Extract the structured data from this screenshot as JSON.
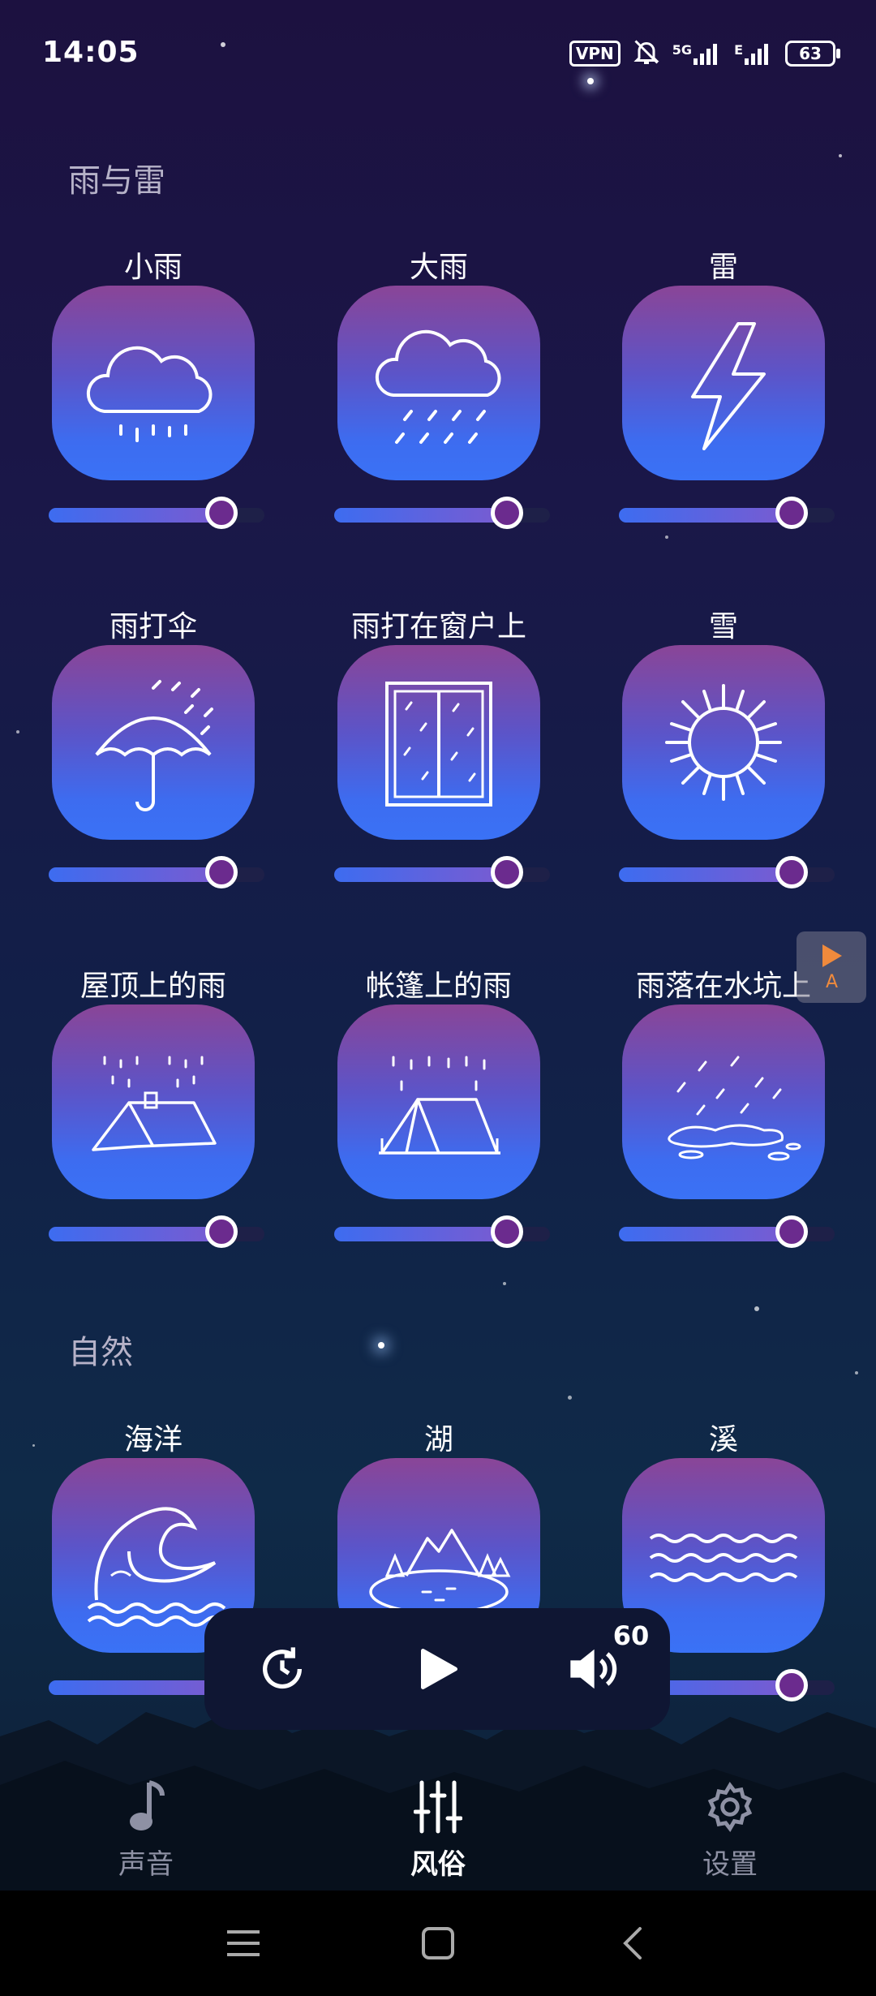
{
  "status": {
    "time": "14:05",
    "vpn": "VPN",
    "network": "5G",
    "network2": "E",
    "battery": "63"
  },
  "sections": {
    "rain": "雨与雷",
    "nature": "自然"
  },
  "tiles": [
    {
      "name": "小雨",
      "icon": "light-rain-icon",
      "volume": 0.8
    },
    {
      "name": "大雨",
      "icon": "heavy-rain-icon",
      "volume": 0.8
    },
    {
      "name": "雷",
      "icon": "thunder-icon",
      "volume": 0.8
    },
    {
      "name": "雨打伞",
      "icon": "umbrella-rain-icon",
      "volume": 0.8
    },
    {
      "name": "雨打在窗户上",
      "icon": "window-rain-icon",
      "volume": 0.8
    },
    {
      "name": "雪",
      "icon": "snowflake-icon",
      "volume": 0.8
    },
    {
      "name": "屋顶上的雨",
      "icon": "roof-rain-icon",
      "volume": 0.8
    },
    {
      "name": "帐篷上的雨",
      "icon": "tent-rain-icon",
      "volume": 0.8
    },
    {
      "name": "雨落在水坑上",
      "icon": "puddle-rain-icon",
      "volume": 0.8
    },
    {
      "name": "海洋",
      "icon": "ocean-wave-icon",
      "volume": 0.8
    },
    {
      "name": "湖",
      "icon": "lake-icon",
      "volume": 0.8
    },
    {
      "name": "溪",
      "icon": "stream-icon",
      "volume": 0.8
    }
  ],
  "side_button": {
    "icon": "play-translate-icon",
    "text": "A"
  },
  "player": {
    "timer_icon": "timer-icon",
    "play_icon": "play-icon",
    "volume_icon": "volume-icon",
    "volume": "60"
  },
  "tabs": [
    {
      "label": "声音",
      "icon": "music-note-icon",
      "active": false
    },
    {
      "label": "风俗",
      "icon": "mixer-sliders-icon",
      "active": true
    },
    {
      "label": "设置",
      "icon": "gear-icon",
      "active": false
    }
  ],
  "colors": {
    "card_top": "#8a4597",
    "card_bottom": "#3a72f6",
    "knob": "#6b2b8e",
    "accent_orange": "#f08a3c"
  }
}
